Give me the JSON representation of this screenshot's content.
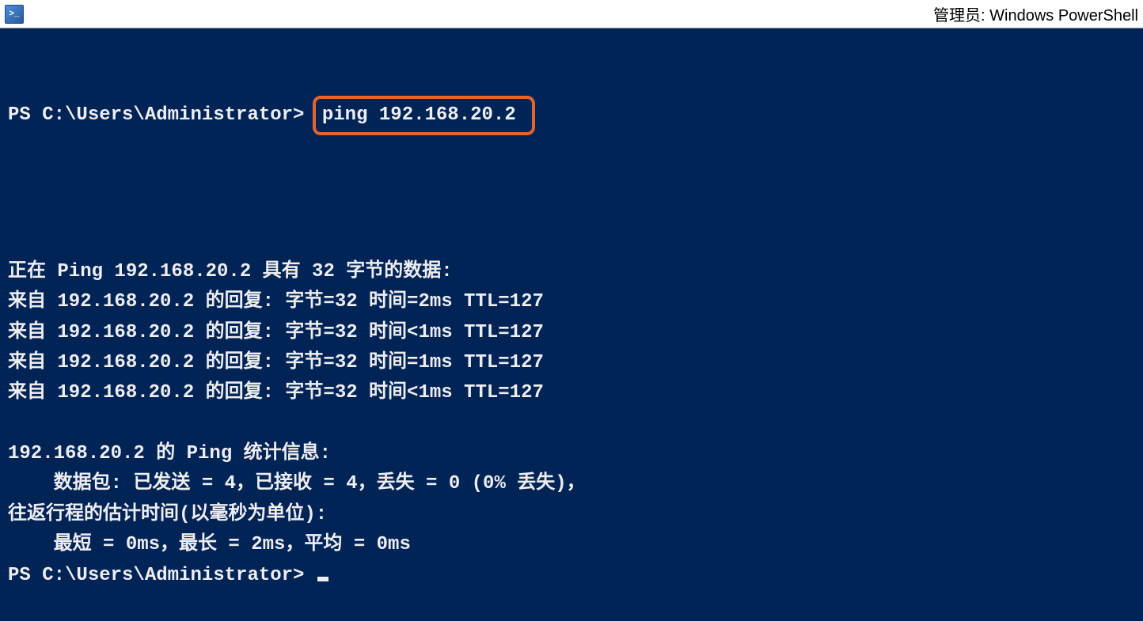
{
  "window": {
    "title": "管理员: Windows PowerShell"
  },
  "terminal": {
    "prompt1": "PS C:\\Users\\Administrator> ",
    "command": "ping 192.168.20.2",
    "blank1": "",
    "ping_header": "正在 Ping 192.168.20.2 具有 32 字节的数据:",
    "reply1": "来自 192.168.20.2 的回复: 字节=32 时间=2ms TTL=127",
    "reply2": "来自 192.168.20.2 的回复: 字节=32 时间<1ms TTL=127",
    "reply3": "来自 192.168.20.2 的回复: 字节=32 时间=1ms TTL=127",
    "reply4": "来自 192.168.20.2 的回复: 字节=32 时间<1ms TTL=127",
    "blank2": "",
    "stats_header": "192.168.20.2 的 Ping 统计信息:",
    "stats_packets": "    数据包: 已发送 = 4，已接收 = 4，丢失 = 0 (0% 丢失)，",
    "stats_rtt_header": "往返行程的估计时间(以毫秒为单位):",
    "stats_rtt": "    最短 = 0ms，最长 = 2ms，平均 = 0ms",
    "prompt2": "PS C:\\Users\\Administrator> "
  }
}
